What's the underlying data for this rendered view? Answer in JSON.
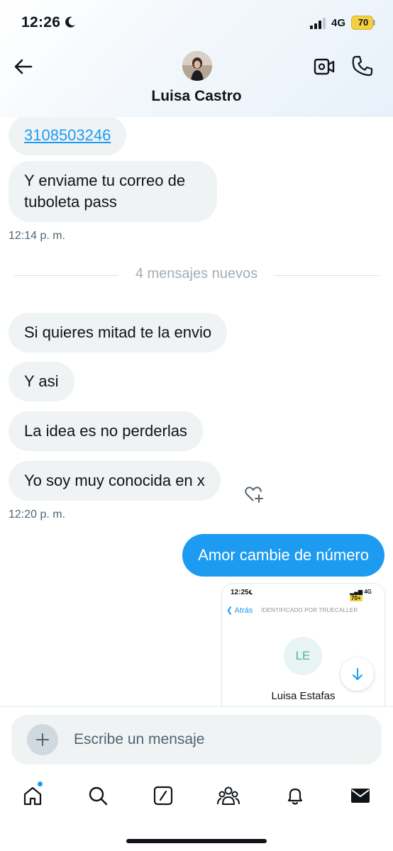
{
  "status_bar": {
    "time": "12:26",
    "network": "4G",
    "battery": "70"
  },
  "header": {
    "contact_name": "Luisa Castro"
  },
  "messages_before": [
    {
      "text": "3108503246",
      "link": true
    },
    {
      "text": "Y enviame tu correo de tuboleta pass"
    }
  ],
  "timestamp_1": "12:14 p. m.",
  "divider": "4 mensajes nuevos",
  "messages_after": [
    {
      "text": "Si quieres mitad te la envio"
    },
    {
      "text": "Y asi"
    },
    {
      "text": "La idea es no perderlas"
    },
    {
      "text": "Yo soy muy conocida en x"
    }
  ],
  "timestamp_2": "12:20 p. m.",
  "outgoing_message": "Amor cambie de número",
  "shared_image": {
    "time": "12:25",
    "network": "4G",
    "battery": "70+",
    "back_label": "Atrás",
    "identified_label": "IDENTIFICADO POR TRUECALLER",
    "initials": "LE",
    "name": "Luisa Estafas"
  },
  "composer": {
    "placeholder": "Escribe un mensaje"
  },
  "nav_items": [
    "home",
    "search",
    "grok",
    "communities",
    "notifications",
    "messages"
  ],
  "colors": {
    "accent": "#1d9bf0",
    "bubble_in": "#eff3f4",
    "text": "#0f1419",
    "muted": "#536471"
  }
}
